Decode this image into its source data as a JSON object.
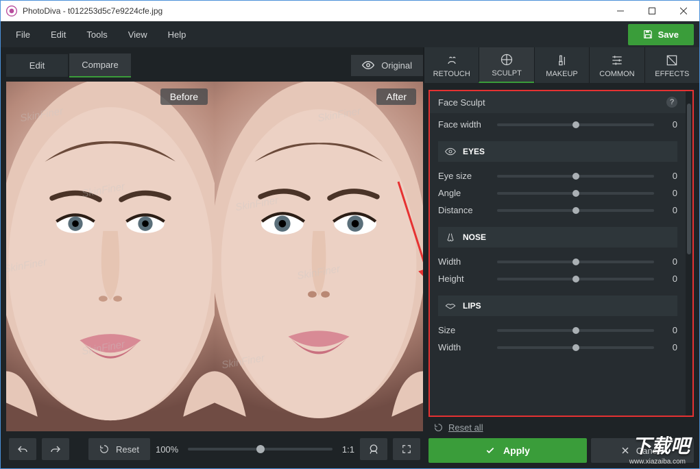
{
  "window": {
    "app": "PhotoDiva",
    "file": "t012253d5c7e9224cfe.jpg"
  },
  "menu": {
    "file": "File",
    "edit": "Edit",
    "tools": "Tools",
    "view": "View",
    "help": "Help",
    "save": "Save"
  },
  "viewtabs": {
    "edit": "Edit",
    "compare": "Compare",
    "original": "Original",
    "before": "Before",
    "after": "After"
  },
  "bottom": {
    "reset": "Reset",
    "zoom": "100%",
    "ratio": "1:1"
  },
  "modes": {
    "retouch": "RETOUCH",
    "sculpt": "SCULPT",
    "makeup": "MAKEUP",
    "common": "COMMON",
    "effects": "EFFECTS"
  },
  "panel": {
    "title": "Face Sculpt",
    "groups": {
      "face": {
        "facewidth": {
          "label": "Face width",
          "value": "0"
        }
      },
      "eyes": {
        "title": "EYES",
        "size": {
          "label": "Eye size",
          "value": "0"
        },
        "angle": {
          "label": "Angle",
          "value": "0"
        },
        "distance": {
          "label": "Distance",
          "value": "0"
        }
      },
      "nose": {
        "title": "NOSE",
        "width": {
          "label": "Width",
          "value": "0"
        },
        "height": {
          "label": "Height",
          "value": "0"
        }
      },
      "lips": {
        "title": "LIPS",
        "size": {
          "label": "Size",
          "value": "0"
        },
        "width": {
          "label": "Width",
          "value": "0"
        }
      }
    },
    "reset_all": "Reset all",
    "apply": "Apply",
    "cancel": "Cancel"
  },
  "watermarks": {
    "skin": "SkinFiner",
    "site": "下载吧",
    "siteurl": "www.xiazaiba.com"
  }
}
